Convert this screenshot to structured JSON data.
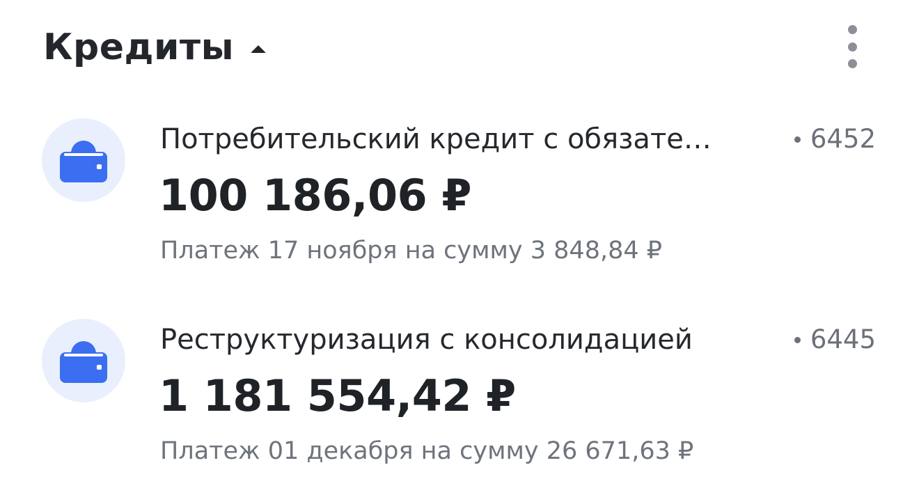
{
  "header": {
    "title": "Кредиты",
    "toggle_icon": "caret-up-icon",
    "menu_icon": "more-vertical-icon"
  },
  "colors": {
    "icon_background": "#e9effc",
    "icon_accent": "#3b6ef0",
    "primary_text": "#1f2226",
    "secondary_text": "#6e737c"
  },
  "loans": [
    {
      "name": "Потребительский кредит с обязательством",
      "name_displayed": "Потребительский кредит с обязате…",
      "account": "6452",
      "amount": "100 186,06 ₽",
      "payment": "Платеж 17 ноября на сумму 3 848,84 ₽",
      "icon": "wallet-icon"
    },
    {
      "name": "Реструктуризация с консолидацией",
      "name_displayed": "Реструктуризация с консолидацией",
      "account": "6445",
      "amount": "1 181 554,42 ₽",
      "payment": "Платеж 01 декабря на сумму 26 671,63 ₽",
      "icon": "wallet-icon"
    }
  ]
}
